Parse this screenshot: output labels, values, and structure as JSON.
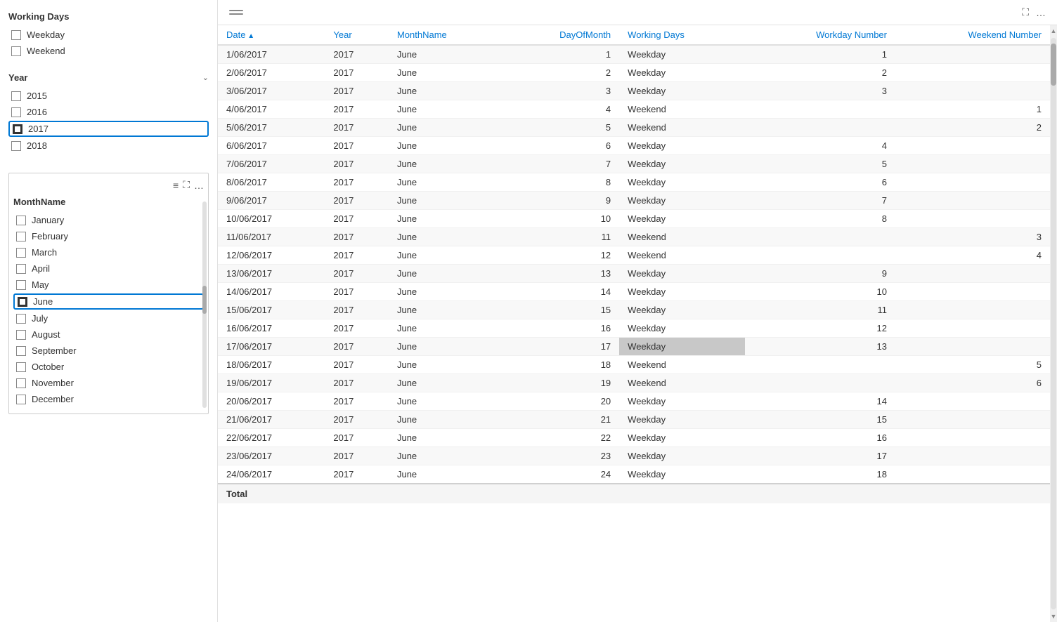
{
  "sidebar": {
    "working_days": {
      "title": "Working Days",
      "items": [
        {
          "label": "Weekday",
          "checked": false
        },
        {
          "label": "Weekend",
          "checked": false
        }
      ]
    },
    "year": {
      "title": "Year",
      "items": [
        {
          "label": "2015",
          "checked": false
        },
        {
          "label": "2016",
          "checked": false
        },
        {
          "label": "2017",
          "checked": true,
          "selected": true
        },
        {
          "label": "2018",
          "checked": false
        }
      ]
    },
    "month": {
      "title": "MonthName",
      "items": [
        {
          "label": "January",
          "checked": false
        },
        {
          "label": "February",
          "checked": false
        },
        {
          "label": "March",
          "checked": false
        },
        {
          "label": "April",
          "checked": false
        },
        {
          "label": "May",
          "checked": false
        },
        {
          "label": "June",
          "checked": true,
          "selected": true
        },
        {
          "label": "July",
          "checked": false
        },
        {
          "label": "August",
          "checked": false
        },
        {
          "label": "September",
          "checked": false
        },
        {
          "label": "October",
          "checked": false
        },
        {
          "label": "November",
          "checked": false
        },
        {
          "label": "December",
          "checked": false
        }
      ]
    }
  },
  "table": {
    "columns": [
      {
        "label": "Date",
        "key": "date",
        "sortable": true,
        "align": "left"
      },
      {
        "label": "Year",
        "key": "year",
        "align": "left"
      },
      {
        "label": "MonthName",
        "key": "monthName",
        "align": "left"
      },
      {
        "label": "DayOfMonth",
        "key": "dayOfMonth",
        "align": "right"
      },
      {
        "label": "Working Days",
        "key": "workingDays",
        "align": "left"
      },
      {
        "label": "Workday Number",
        "key": "workdayNumber",
        "align": "right"
      },
      {
        "label": "Weekend Number",
        "key": "weekendNumber",
        "align": "right"
      }
    ],
    "rows": [
      {
        "date": "1/06/2017",
        "year": "2017",
        "monthName": "June",
        "dayOfMonth": "1",
        "workingDays": "Weekday",
        "workdayNumber": "1",
        "weekendNumber": ""
      },
      {
        "date": "2/06/2017",
        "year": "2017",
        "monthName": "June",
        "dayOfMonth": "2",
        "workingDays": "Weekday",
        "workdayNumber": "2",
        "weekendNumber": ""
      },
      {
        "date": "3/06/2017",
        "year": "2017",
        "monthName": "June",
        "dayOfMonth": "3",
        "workingDays": "Weekday",
        "workdayNumber": "3",
        "weekendNumber": ""
      },
      {
        "date": "4/06/2017",
        "year": "2017",
        "monthName": "June",
        "dayOfMonth": "4",
        "workingDays": "Weekend",
        "workdayNumber": "",
        "weekendNumber": "1"
      },
      {
        "date": "5/06/2017",
        "year": "2017",
        "monthName": "June",
        "dayOfMonth": "5",
        "workingDays": "Weekend",
        "workdayNumber": "",
        "weekendNumber": "2"
      },
      {
        "date": "6/06/2017",
        "year": "2017",
        "monthName": "June",
        "dayOfMonth": "6",
        "workingDays": "Weekday",
        "workdayNumber": "4",
        "weekendNumber": ""
      },
      {
        "date": "7/06/2017",
        "year": "2017",
        "monthName": "June",
        "dayOfMonth": "7",
        "workingDays": "Weekday",
        "workdayNumber": "5",
        "weekendNumber": ""
      },
      {
        "date": "8/06/2017",
        "year": "2017",
        "monthName": "June",
        "dayOfMonth": "8",
        "workingDays": "Weekday",
        "workdayNumber": "6",
        "weekendNumber": ""
      },
      {
        "date": "9/06/2017",
        "year": "2017",
        "monthName": "June",
        "dayOfMonth": "9",
        "workingDays": "Weekday",
        "workdayNumber": "7",
        "weekendNumber": ""
      },
      {
        "date": "10/06/2017",
        "year": "2017",
        "monthName": "June",
        "dayOfMonth": "10",
        "workingDays": "Weekday",
        "workdayNumber": "8",
        "weekendNumber": ""
      },
      {
        "date": "11/06/2017",
        "year": "2017",
        "monthName": "June",
        "dayOfMonth": "11",
        "workingDays": "Weekend",
        "workdayNumber": "",
        "weekendNumber": "3"
      },
      {
        "date": "12/06/2017",
        "year": "2017",
        "monthName": "June",
        "dayOfMonth": "12",
        "workingDays": "Weekend",
        "workdayNumber": "",
        "weekendNumber": "4"
      },
      {
        "date": "13/06/2017",
        "year": "2017",
        "monthName": "June",
        "dayOfMonth": "13",
        "workingDays": "Weekday",
        "workdayNumber": "9",
        "weekendNumber": ""
      },
      {
        "date": "14/06/2017",
        "year": "2017",
        "monthName": "June",
        "dayOfMonth": "14",
        "workingDays": "Weekday",
        "workdayNumber": "10",
        "weekendNumber": ""
      },
      {
        "date": "15/06/2017",
        "year": "2017",
        "monthName": "June",
        "dayOfMonth": "15",
        "workingDays": "Weekday",
        "workdayNumber": "11",
        "weekendNumber": ""
      },
      {
        "date": "16/06/2017",
        "year": "2017",
        "monthName": "June",
        "dayOfMonth": "16",
        "workingDays": "Weekday",
        "workdayNumber": "12",
        "weekendNumber": ""
      },
      {
        "date": "17/06/2017",
        "year": "2017",
        "monthName": "June",
        "dayOfMonth": "17",
        "workingDays": "Weekday",
        "workdayNumber": "13",
        "weekendNumber": "",
        "highlight": true
      },
      {
        "date": "18/06/2017",
        "year": "2017",
        "monthName": "June",
        "dayOfMonth": "18",
        "workingDays": "Weekend",
        "workdayNumber": "",
        "weekendNumber": "5"
      },
      {
        "date": "19/06/2017",
        "year": "2017",
        "monthName": "June",
        "dayOfMonth": "19",
        "workingDays": "Weekend",
        "workdayNumber": "",
        "weekendNumber": "6"
      },
      {
        "date": "20/06/2017",
        "year": "2017",
        "monthName": "June",
        "dayOfMonth": "20",
        "workingDays": "Weekday",
        "workdayNumber": "14",
        "weekendNumber": ""
      },
      {
        "date": "21/06/2017",
        "year": "2017",
        "monthName": "June",
        "dayOfMonth": "21",
        "workingDays": "Weekday",
        "workdayNumber": "15",
        "weekendNumber": ""
      },
      {
        "date": "22/06/2017",
        "year": "2017",
        "monthName": "June",
        "dayOfMonth": "22",
        "workingDays": "Weekday",
        "workdayNumber": "16",
        "weekendNumber": ""
      },
      {
        "date": "23/06/2017",
        "year": "2017",
        "monthName": "June",
        "dayOfMonth": "23",
        "workingDays": "Weekday",
        "workdayNumber": "17",
        "weekendNumber": ""
      },
      {
        "date": "24/06/2017",
        "year": "2017",
        "monthName": "June",
        "dayOfMonth": "24",
        "workingDays": "Weekday",
        "workdayNumber": "18",
        "weekendNumber": ""
      }
    ],
    "footer": {
      "label": "Total"
    }
  }
}
